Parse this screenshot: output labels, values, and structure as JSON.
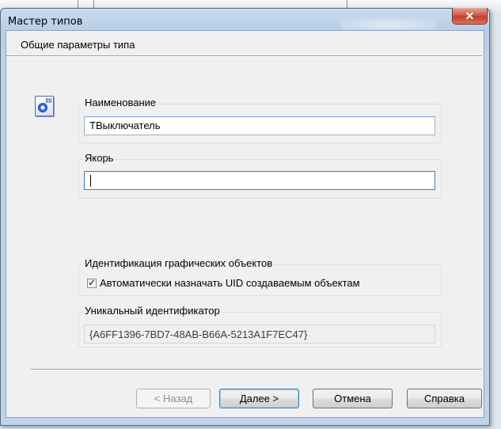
{
  "window": {
    "title": "Мастер типов",
    "close_glyph": "✕"
  },
  "page": {
    "heading": "Общие параметры типа"
  },
  "type_icon": "type-wizard-icon",
  "name_group": {
    "label": "Наименование",
    "value": "ТВыключатель"
  },
  "anchor_group": {
    "label": "Якорь",
    "value": ""
  },
  "identification_group": {
    "label": "Идентификация графических объектов",
    "checkbox_label": "Автоматически назначать UID создаваемым объектам",
    "checked": true,
    "check_glyph": "✓"
  },
  "uid_group": {
    "label": "Уникальный идентификатор",
    "value": "{A6FF1396-7BD7-48AB-B66A-5213A1F7EC47}"
  },
  "buttons": {
    "back": "< Назад",
    "next": "Далее >",
    "cancel": "Отмена",
    "help": "Справка"
  }
}
